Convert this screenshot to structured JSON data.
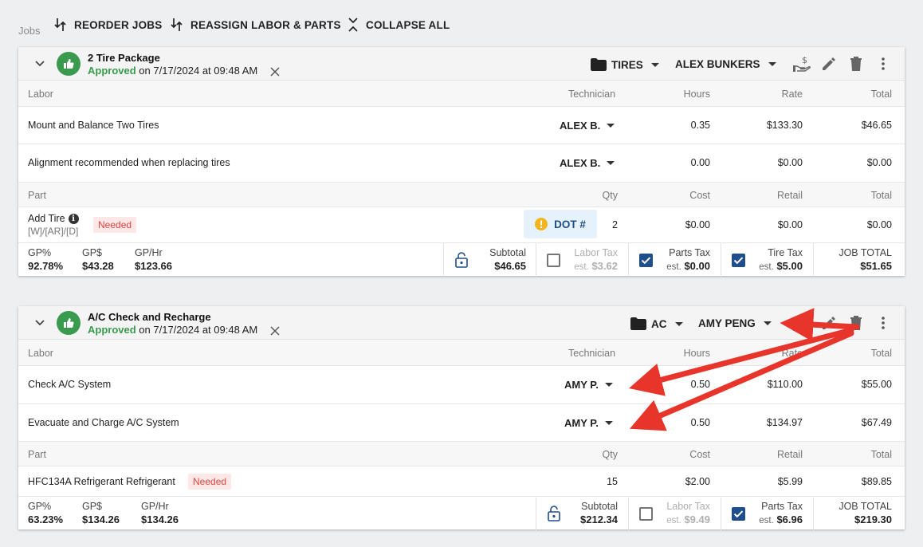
{
  "toolbar": {
    "jobs_label": "Jobs",
    "reorder": "REORDER JOBS",
    "reassign": "REASSIGN LABOR & PARTS",
    "collapse": "COLLAPSE ALL"
  },
  "colors": {
    "approved": "#3a9a4d",
    "needed_bg": "#fde7e7",
    "needed_text": "#e0453f",
    "checkbox": "#1e4e8c",
    "annotation_arrow": "#e8352b"
  },
  "jobs": [
    {
      "title": "2 Tire Package",
      "status": "Approved",
      "date_text": "on 7/17/2024 at 09:48 AM",
      "category": "TIRES",
      "assignee": "ALEX BUNKERS",
      "labor_headers": {
        "labor": "Labor",
        "technician": "Technician",
        "hours": "Hours",
        "rate": "Rate",
        "total": "Total"
      },
      "labor": [
        {
          "name": "Mount and Balance Two Tires",
          "tech": "ALEX B.",
          "hours": "0.35",
          "rate": "$133.30",
          "total": "$46.65"
        },
        {
          "name": "Alignment recommended when replacing tires",
          "tech": "ALEX B.",
          "hours": "0.00",
          "rate": "$0.00",
          "total": "$0.00"
        }
      ],
      "part_headers": {
        "part": "Part",
        "qty": "Qty",
        "cost": "Cost",
        "retail": "Retail",
        "total": "Total"
      },
      "parts": [
        {
          "name": "Add Tire",
          "sub": "[W]/[AR]/[D]",
          "badge": "Needed",
          "dot_label": "DOT #",
          "qty": "2",
          "cost": "$0.00",
          "retail": "$0.00",
          "total": "$0.00"
        }
      ],
      "footer": {
        "gp_pct_label": "GP%",
        "gp_pct": "92.78%",
        "gp_dollar_label": "GP$",
        "gp_dollar": "$43.28",
        "gp_hr_label": "GP/Hr",
        "gp_hr": "$123.66",
        "subtotal_label": "Subtotal",
        "subtotal": "$46.65",
        "labor_tax_label": "Labor Tax",
        "labor_tax_est": "est.",
        "labor_tax": "$3.62",
        "parts_tax_label": "Parts Tax",
        "parts_tax_est": "est.",
        "parts_tax": "$0.00",
        "tire_tax_label": "Tire Tax",
        "tire_tax_est": "est.",
        "tire_tax": "$5.00",
        "job_total_label": "JOB TOTAL",
        "job_total": "$51.65"
      }
    },
    {
      "title": "A/C Check and Recharge",
      "status": "Approved",
      "date_text": "on 7/17/2024 at 09:48 AM",
      "category": "AC",
      "assignee": "AMY PENG",
      "labor_headers": {
        "labor": "Labor",
        "technician": "Technician",
        "hours": "Hours",
        "rate": "Rate",
        "total": "Total"
      },
      "labor": [
        {
          "name": "Check A/C System",
          "tech": "AMY P.",
          "hours": "0.50",
          "rate": "$110.00",
          "total": "$55.00"
        },
        {
          "name": "Evacuate and Charge A/C System",
          "tech": "AMY P.",
          "hours": "0.50",
          "rate": "$134.97",
          "total": "$67.49"
        }
      ],
      "part_headers": {
        "part": "Part",
        "qty": "Qty",
        "cost": "Cost",
        "retail": "Retail",
        "total": "Total"
      },
      "parts": [
        {
          "name": "HFC134A Refrigerant Refrigerant",
          "badge": "Needed",
          "qty": "15",
          "cost": "$2.00",
          "retail": "$5.99",
          "total": "$89.85"
        }
      ],
      "footer": {
        "gp_pct_label": "GP%",
        "gp_pct": "63.23%",
        "gp_dollar_label": "GP$",
        "gp_dollar": "$134.26",
        "gp_hr_label": "GP/Hr",
        "gp_hr": "$134.26",
        "subtotal_label": "Subtotal",
        "subtotal": "$212.34",
        "labor_tax_label": "Labor Tax",
        "labor_tax_est": "est.",
        "labor_tax": "$9.49",
        "parts_tax_label": "Parts Tax",
        "parts_tax_est": "est.",
        "parts_tax": "$6.96",
        "job_total_label": "JOB TOTAL",
        "job_total": "$219.30"
      }
    }
  ]
}
